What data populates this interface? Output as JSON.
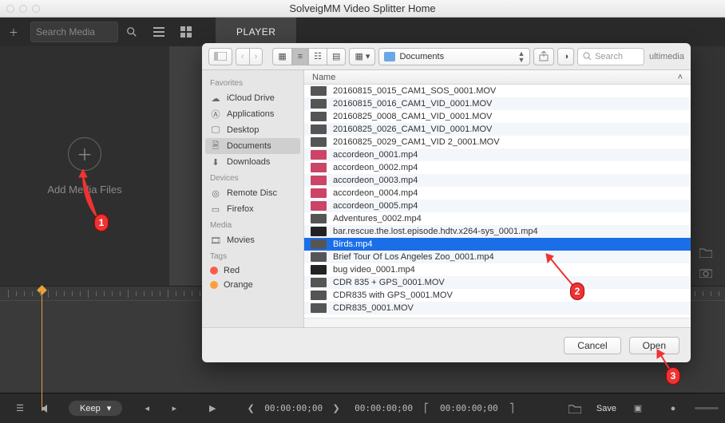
{
  "window": {
    "title": "SolveigMM Video Splitter Home"
  },
  "topbar": {
    "search_placeholder": "Search Media",
    "tab_player": "PLAYER"
  },
  "leftpanel": {
    "add_label": "Add Media Files"
  },
  "bottombar": {
    "keep_label": "Keep",
    "tc1": "00:00:00;00",
    "tc2": "00:00:00;00",
    "tc3": "00:00:00;00",
    "save_label": "Save"
  },
  "dialog": {
    "path_label": "Documents",
    "search_placeholder": "Search",
    "trailing_label": "ultimedia",
    "column_name": "Name",
    "sidebar": {
      "favorites_head": "Favorites",
      "devices_head": "Devices",
      "media_head": "Media",
      "tags_head": "Tags",
      "items": {
        "icloud": "iCloud Drive",
        "apps": "Applications",
        "desktop": "Desktop",
        "documents": "Documents",
        "downloads": "Downloads",
        "remote": "Remote Disc",
        "firefox": "Firefox",
        "movies": "Movies",
        "red": "Red",
        "orange": "Orange"
      }
    },
    "files": [
      {
        "name": "20160815_0015_CAM1_SOS_0001.MOV",
        "cls": ""
      },
      {
        "name": "20160815_0016_CAM1_VID_0001.MOV",
        "cls": ""
      },
      {
        "name": "20160825_0008_CAM1_VID_0001.MOV",
        "cls": ""
      },
      {
        "name": "20160825_0026_CAM1_VID_0001.MOV",
        "cls": ""
      },
      {
        "name": "20160825_0029_CAM1_VID 2_0001.MOV",
        "cls": ""
      },
      {
        "name": "accordeon_0001.mp4",
        "cls": "pink"
      },
      {
        "name": "accordeon_0002.mp4",
        "cls": "pink"
      },
      {
        "name": "accordeon_0003.mp4",
        "cls": "pink"
      },
      {
        "name": "accordeon_0004.mp4",
        "cls": "pink"
      },
      {
        "name": "accordeon_0005.mp4",
        "cls": "pink"
      },
      {
        "name": "Adventures_0002.mp4",
        "cls": ""
      },
      {
        "name": "bar.rescue.the.lost.episode.hdtv.x264-sys_0001.mp4",
        "cls": "dk"
      },
      {
        "name": "Birds.mp4",
        "cls": "",
        "selected": true
      },
      {
        "name": "Brief Tour Of Los Angeles Zoo_0001.mp4",
        "cls": ""
      },
      {
        "name": "bug video_0001.mp4",
        "cls": "dk"
      },
      {
        "name": "CDR 835 + GPS_0001.MOV",
        "cls": ""
      },
      {
        "name": "CDR835 with GPS_0001.MOV",
        "cls": ""
      },
      {
        "name": "CDR835_0001.MOV",
        "cls": ""
      }
    ],
    "cancel": "Cancel",
    "open": "Open"
  },
  "annotations": {
    "a1": "1",
    "a2": "2",
    "a3": "3"
  }
}
